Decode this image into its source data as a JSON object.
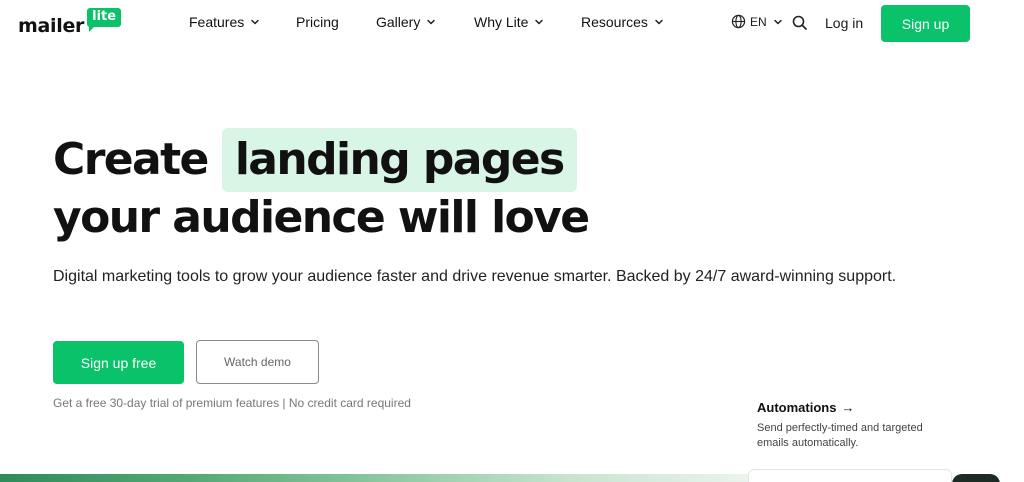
{
  "nav": {
    "logo": {
      "word": "mailer",
      "badge": "lite"
    },
    "menu": [
      {
        "label": "Features",
        "dropdown": true
      },
      {
        "label": "Pricing",
        "dropdown": false
      },
      {
        "label": "Gallery",
        "dropdown": true
      },
      {
        "label": "Why Lite",
        "dropdown": true
      },
      {
        "label": "Resources",
        "dropdown": true
      }
    ],
    "language": "EN",
    "login_label": "Log in",
    "signup_label": "Sign up",
    "search_icon": "search-icon",
    "globe_icon": "globe-icon"
  },
  "hero": {
    "headline_start": "Create",
    "headline_highlight": "landing pages",
    "headline_end": "your audience will love",
    "subtitle": "Digital marketing tools to grow your audience faster and drive revenue smarter. Backed by 24/7 award-winning support.",
    "primary_cta": "Sign up free",
    "secondary_cta": "Watch demo",
    "trial_note": "Get a free 30-day trial of premium features | No credit card required"
  },
  "feature": {
    "title": "Automations",
    "arrow": "→",
    "description": "Send perfectly-timed and targeted emails automatically."
  },
  "colors": {
    "brand_green": "#09c269",
    "highlight_bg": "#d8f5e6",
    "text": "#111111"
  }
}
